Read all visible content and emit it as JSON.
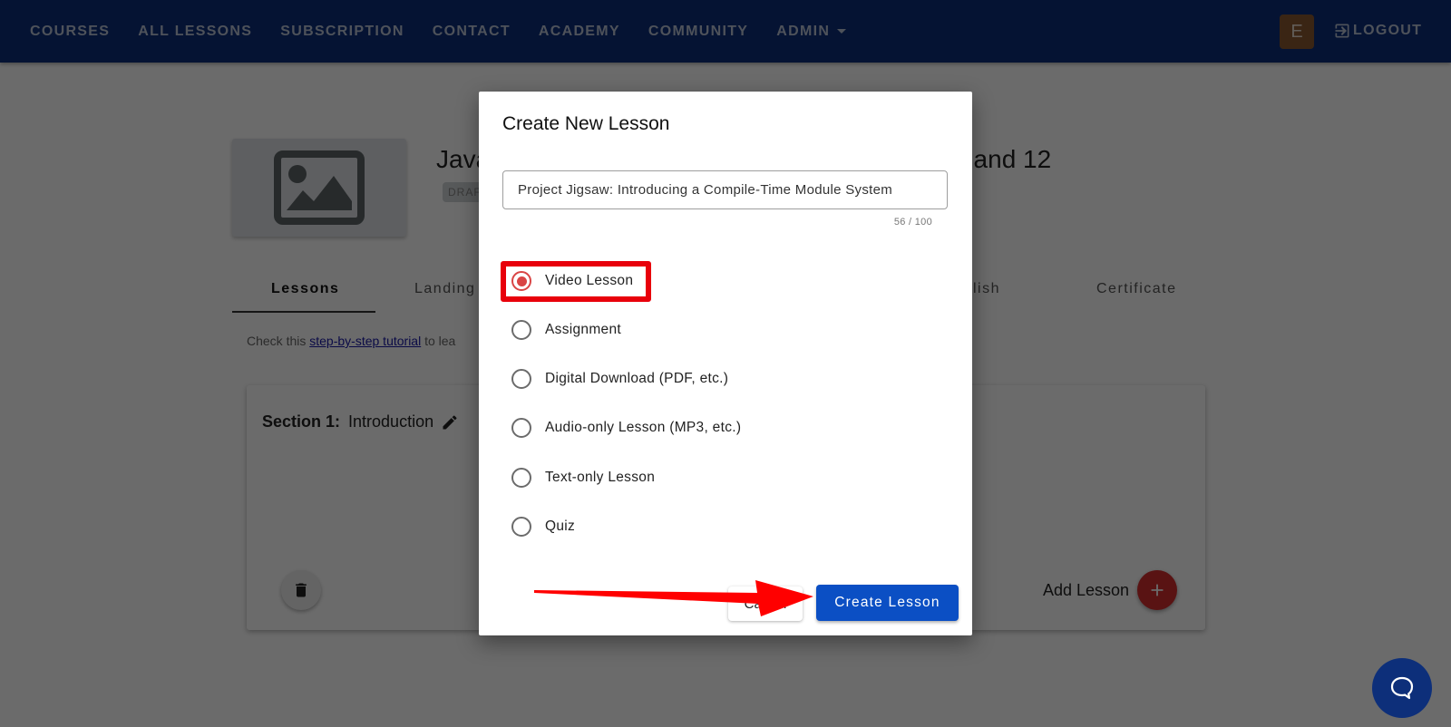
{
  "nav": {
    "items": [
      {
        "label": "COURSES"
      },
      {
        "label": "ALL LESSONS"
      },
      {
        "label": "SUBSCRIPTION"
      },
      {
        "label": "CONTACT"
      },
      {
        "label": "ACADEMY"
      },
      {
        "label": "COMMUNITY"
      },
      {
        "label": "ADMIN",
        "dropdown": true
      }
    ],
    "avatar_letter": "E",
    "logout_label": "LOGOUT",
    "logout_icon": "logout-icon",
    "bg_color": "#0d2f7a"
  },
  "course": {
    "title_start": "Java",
    "title_end": ", and 12",
    "status_badge": "DRAFT",
    "thumbnail_icon": "image-placeholder-icon"
  },
  "tabs": [
    {
      "label": "Lessons",
      "active": true
    },
    {
      "label": "Landing"
    },
    {
      "label": "Publish"
    },
    {
      "label": "Certificate"
    }
  ],
  "help": {
    "prefix": "Check this ",
    "link": "step-by-step tutorial",
    "suffix": " to lea"
  },
  "section": {
    "number_label": "Section 1:",
    "name": "Introduction",
    "edit_icon": "pencil-icon",
    "delete_icon": "trash-icon",
    "add_lesson_label": "Add Lesson",
    "add_icon": "plus-icon"
  },
  "dialog": {
    "title": "Create New Lesson",
    "input_value": "Project Jigsaw: Introducing a Compile-Time Module System",
    "char_count": "56 / 100",
    "lesson_types": [
      {
        "label": "Video Lesson",
        "selected": true
      },
      {
        "label": "Assignment",
        "selected": false
      },
      {
        "label": "Digital Download (PDF, etc.)",
        "selected": false
      },
      {
        "label": "Audio-only Lesson (MP3, etc.)",
        "selected": false
      },
      {
        "label": "Text-only Lesson",
        "selected": false
      },
      {
        "label": "Quiz",
        "selected": false
      }
    ],
    "cancel_label": "Cancel",
    "create_label": "Create Lesson",
    "accent_color": "#0b4fc4",
    "radio_color": "#d94545"
  },
  "annotations": {
    "highlight_color": "#e8000b",
    "arrow_color": "#ff0000"
  },
  "chat_widget": {
    "icon": "chat-bubble-icon"
  }
}
